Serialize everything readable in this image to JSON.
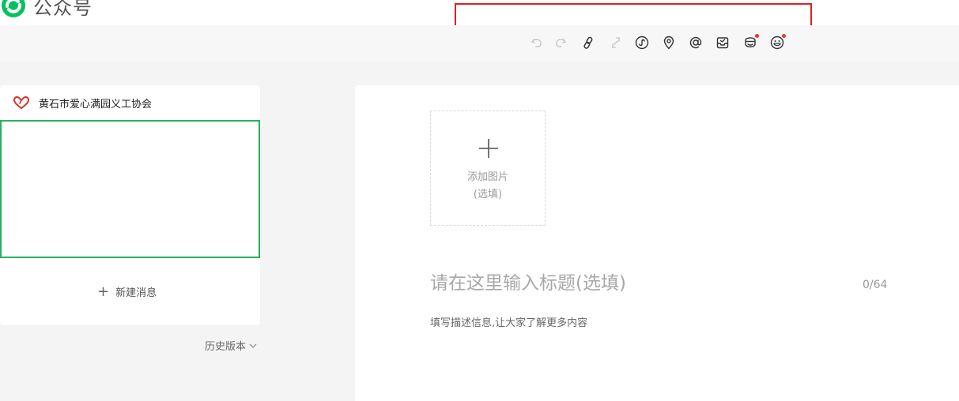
{
  "app": {
    "name": "公众号",
    "brand_color": "#07c160"
  },
  "toolbar": {
    "items": [
      {
        "icon": "undo-icon",
        "enabled": false
      },
      {
        "icon": "redo-icon",
        "enabled": false
      },
      {
        "icon": "link-icon",
        "enabled": true
      },
      {
        "icon": "unlink-icon",
        "enabled": false
      },
      {
        "icon": "mini-program-icon",
        "enabled": true
      },
      {
        "icon": "location-icon",
        "enabled": true
      },
      {
        "icon": "at-icon",
        "enabled": true
      },
      {
        "icon": "inbox-icon",
        "enabled": true
      },
      {
        "icon": "sticker-icon",
        "enabled": true,
        "badge": true
      },
      {
        "icon": "emoji-icon",
        "enabled": true,
        "badge": true
      }
    ],
    "badge_color": "#e53935"
  },
  "sidebar": {
    "account_name": "黄石市爱心满园义工协会",
    "new_message_label": "新建消息",
    "history_label": "历史版本",
    "selected_border_color": "#27b35a"
  },
  "editor": {
    "add_image_line1": "添加图片",
    "add_image_line2": "(选填)",
    "title_placeholder": "请在这里输入标题(选填)",
    "title_counter": "0/64",
    "description_placeholder": "填写描述信息,让大家了解更多内容"
  },
  "highlight": {
    "color": "#e02020"
  }
}
